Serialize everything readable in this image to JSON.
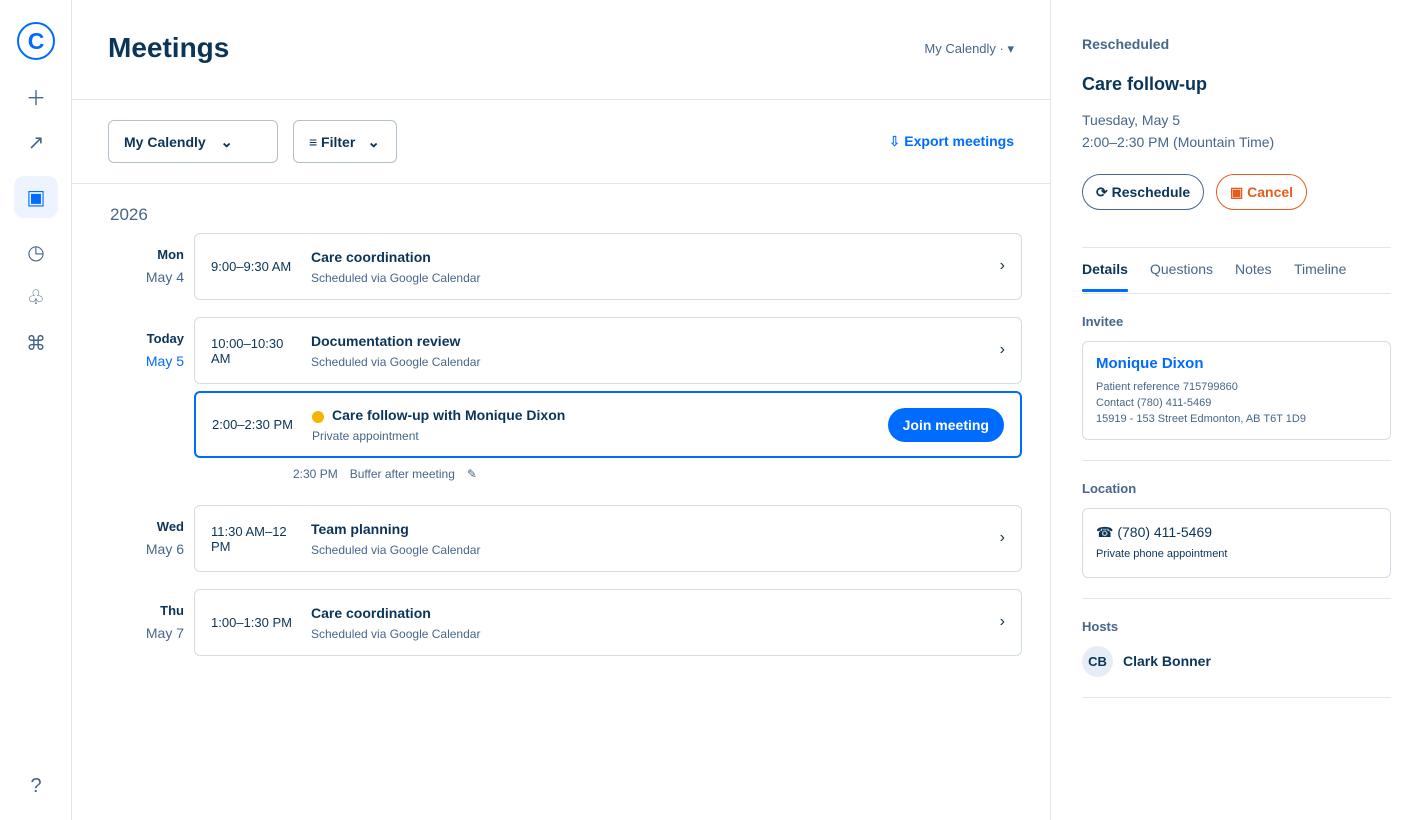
{
  "rail": {
    "logo": "C",
    "icons": {
      "create": "＋",
      "analytics": "↗",
      "meetings": "▣",
      "availability": "◷",
      "contacts": "♧",
      "integrations": "⌘",
      "help": "?"
    }
  },
  "header": {
    "title": "Meetings",
    "account_switch": "My Calendly · ▾"
  },
  "toolbar": {
    "calendar_select": "My Calendly",
    "filter_label": "≡ Filter",
    "chevron": "⌄",
    "export_label": "⇩ Export meetings"
  },
  "list": {
    "year": "2026",
    "days": [
      {
        "dow": "Mon",
        "date": "May 4"
      },
      {
        "dow": "Today",
        "date": "May 5"
      },
      {
        "dow": "Wed",
        "date": "May 6"
      },
      {
        "dow": "Thu",
        "date": "May 7"
      }
    ],
    "meetings": [
      {
        "time": "9:00–9:30 AM",
        "title": "Care coordination",
        "subtitle": "Scheduled via Google Calendar"
      },
      {
        "time": "10:00–10:30 AM",
        "title": "Documentation review",
        "subtitle": "Scheduled via Google Calendar"
      },
      {
        "time": "2:00–2:30 PM",
        "title": "Care follow-up with Monique Dixon",
        "subtitle": "Private appointment",
        "status_color": "#f4b400"
      },
      {
        "time": "11:30 AM–12 PM",
        "title": "Team planning",
        "subtitle": "Scheduled via Google Calendar"
      },
      {
        "time": "1:00–1:30 PM",
        "title": "Care coordination",
        "subtitle": "Scheduled via Google Calendar"
      }
    ],
    "join_label": "Join meeting",
    "arrow": "›",
    "buffer": {
      "time": "2:30 PM",
      "label": "Buffer after meeting",
      "edit_icon": "✎"
    }
  },
  "panel": {
    "status": "Rescheduled",
    "title": "Care follow-up",
    "date": "Tuesday, May 5",
    "timespan": "2:00–2:30 PM (Mountain Time)",
    "reschedule_label": "⟳ Reschedule",
    "cancel_label": "▣ Cancel",
    "tabs": [
      "Details",
      "Questions",
      "Notes",
      "Timeline"
    ],
    "invitee": {
      "section": "Invitee",
      "name": "Monique Dixon",
      "lines": [
        "Patient reference 715799860",
        "Contact (780) 411-5469",
        "15919 - 153 Street Edmonton, AB T6T 1D9"
      ]
    },
    "location": {
      "section": "Location",
      "phone": "☎ (780) 411-5469",
      "note": "Private phone appointment"
    },
    "hosts": {
      "section": "Hosts",
      "initials": "CB",
      "name": "Clark Bonner"
    }
  },
  "colors": {
    "accent": "#006bff",
    "text": "#0b3558",
    "muted": "#476788",
    "cancel": "#e55c1e",
    "pending_dot": "#f4b400"
  }
}
